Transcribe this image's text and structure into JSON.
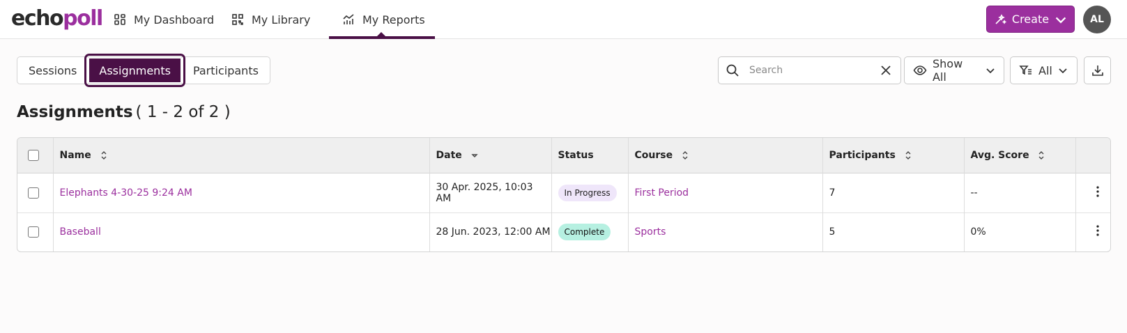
{
  "app": {
    "logo_part1": "echo",
    "logo_part2": "poll"
  },
  "nav": {
    "items": [
      {
        "label": "My Dashboard",
        "icon": "dashboard-icon"
      },
      {
        "label": "My Library",
        "icon": "library-icon"
      },
      {
        "label": "My Reports",
        "icon": "reports-icon",
        "active": true
      }
    ]
  },
  "header": {
    "create_label": "Create",
    "avatar_initials": "AL"
  },
  "tabs": [
    {
      "label": "Sessions"
    },
    {
      "label": "Assignments",
      "active": true
    },
    {
      "label": "Participants"
    }
  ],
  "toolbar": {
    "search_placeholder": "Search",
    "search_value": "",
    "show_filter_label": "Show All",
    "type_filter_label": "All"
  },
  "page": {
    "title": "Assignments",
    "count": "( 1 - 2 of 2 )"
  },
  "table": {
    "columns": {
      "name": "Name",
      "date": "Date",
      "status": "Status",
      "course": "Course",
      "participants": "Participants",
      "avg_score": "Avg. Score"
    },
    "rows": [
      {
        "name": "Elephants 4-30-25 9:24 AM",
        "date": "30 Apr. 2025, 10:03 AM",
        "status": "In Progress",
        "course": "First Period",
        "participants": "7",
        "avg_score": "--"
      },
      {
        "name": "Baseball",
        "date": "28 Jun. 2023, 12:00 AM",
        "status": "Complete",
        "course": "Sports",
        "participants": "5",
        "avg_score": "0%"
      }
    ]
  },
  "colors": {
    "brand": "#9b2f9e",
    "brand_dark": "#4a1046",
    "in_progress_bg": "#efe6fa",
    "complete_bg": "#b6f0e1"
  }
}
